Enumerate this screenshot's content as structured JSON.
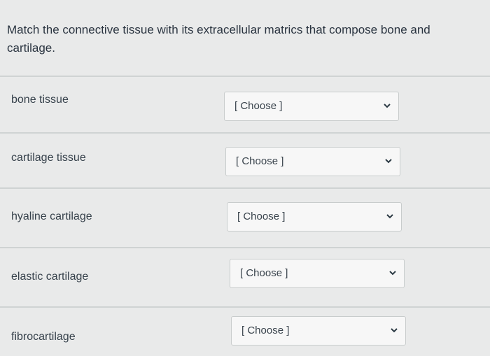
{
  "question": {
    "text": "Match the connective tissue with its extracellular matrics that compose bone and cartilage."
  },
  "rows": [
    {
      "label": "bone tissue",
      "selected": "[ Choose ]"
    },
    {
      "label": "cartilage tissue",
      "selected": "[ Choose ]"
    },
    {
      "label": "hyaline cartilage",
      "selected": "[ Choose ]"
    },
    {
      "label": "elastic cartilage",
      "selected": "[ Choose ]"
    },
    {
      "label": "fibrocartilage",
      "selected": "[ Choose ]"
    }
  ],
  "icons": {
    "dropdown": "chevron-down-icon"
  }
}
